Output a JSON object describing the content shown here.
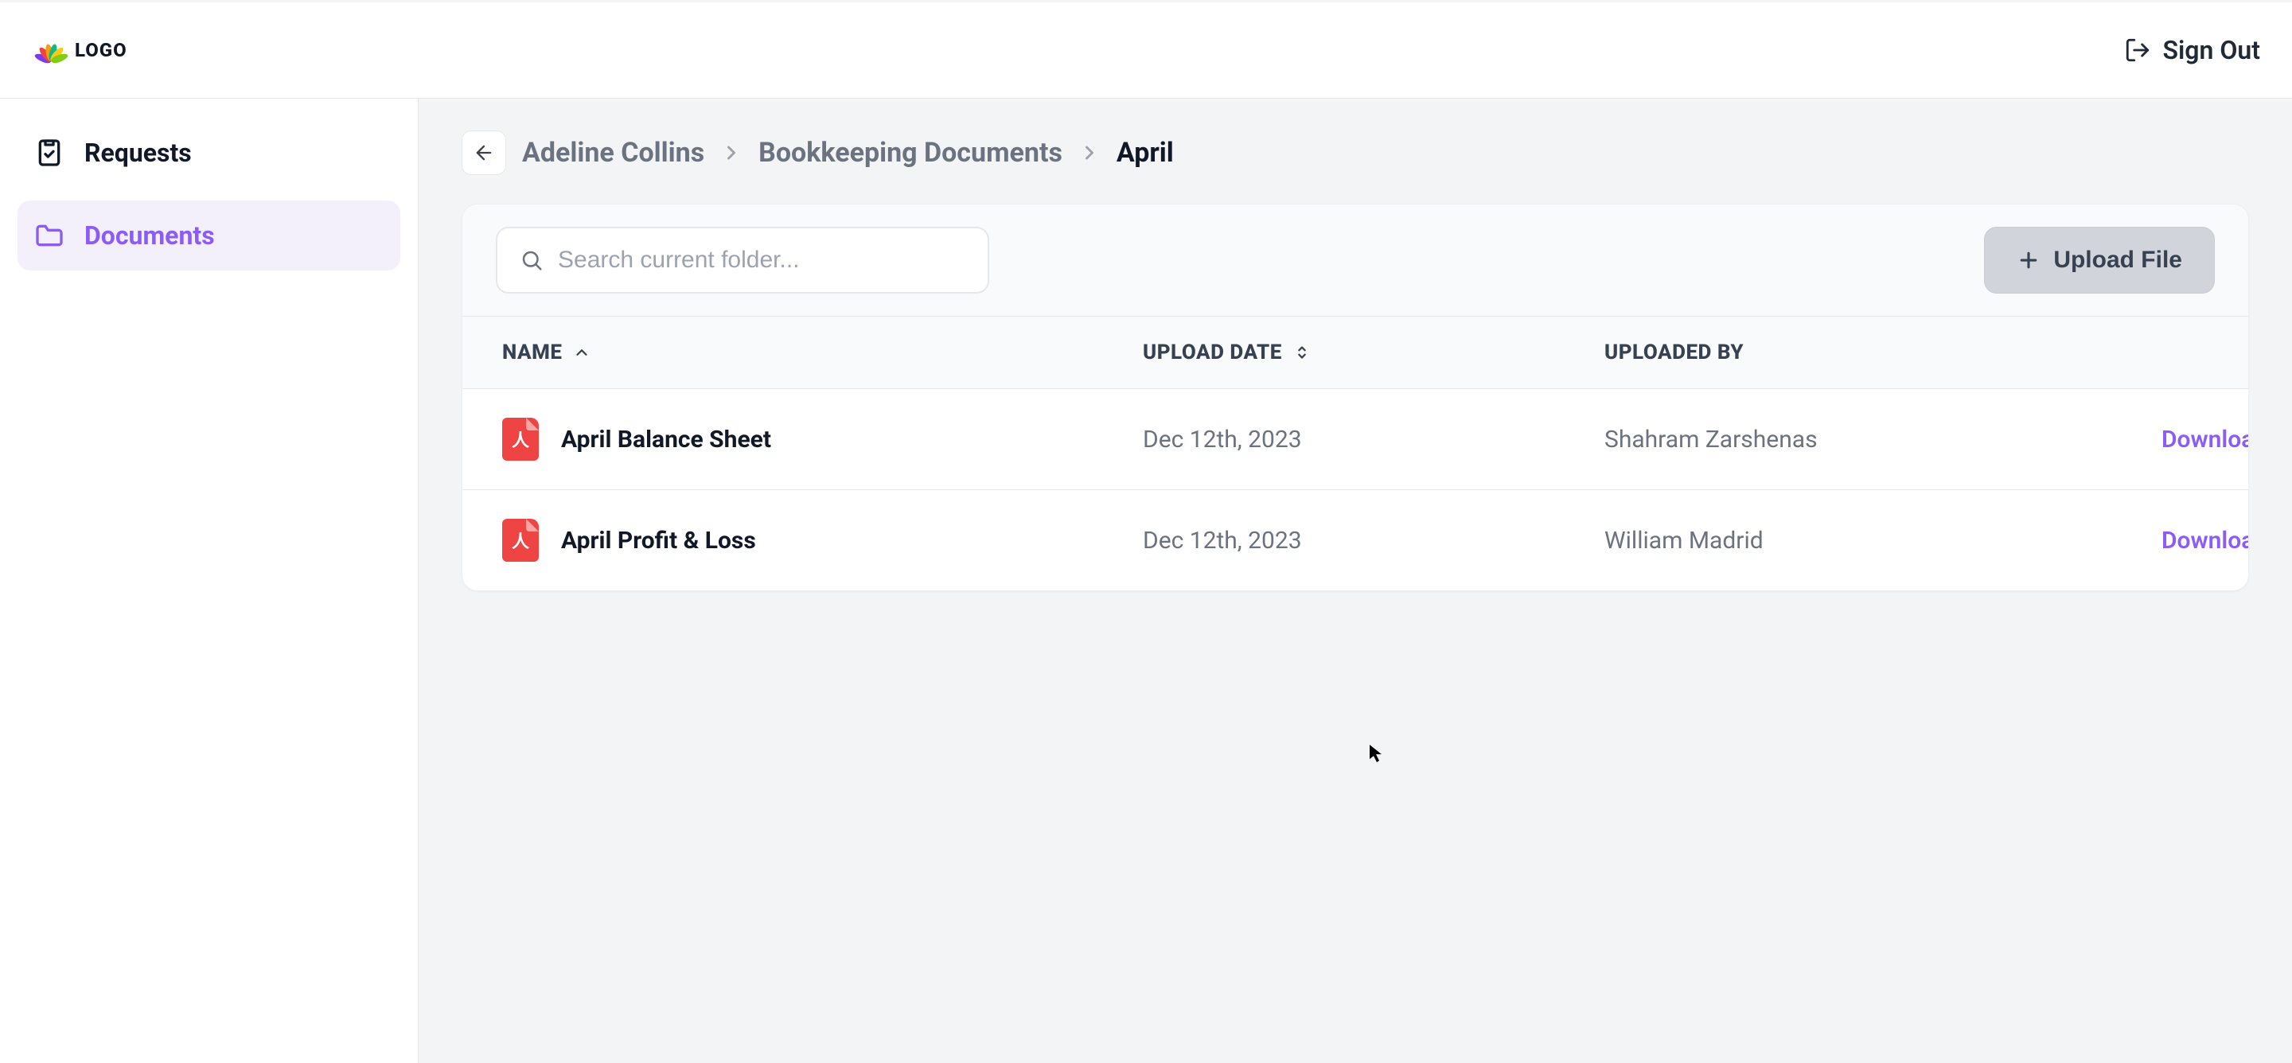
{
  "header": {
    "logo_text": "LOGO",
    "signout_label": "Sign Out"
  },
  "sidebar": {
    "items": [
      {
        "label": "Requests",
        "active": false,
        "icon": "clipboard-check-icon"
      },
      {
        "label": "Documents",
        "active": true,
        "icon": "folder-icon"
      }
    ]
  },
  "breadcrumb": {
    "items": [
      {
        "label": "Adeline Collins",
        "current": false
      },
      {
        "label": "Bookkeeping Documents",
        "current": false
      },
      {
        "label": "April",
        "current": true
      }
    ]
  },
  "search": {
    "placeholder": "Search current folder..."
  },
  "upload_button_label": "Upload File",
  "table": {
    "columns": {
      "name": "NAME",
      "upload_date": "UPLOAD DATE",
      "uploaded_by": "UPLOADED BY"
    },
    "rows": [
      {
        "name": "April Balance Sheet",
        "upload_date": "Dec 12th, 2023",
        "uploaded_by": "Shahram Zarshenas",
        "action": "Download",
        "file_glyph": "人"
      },
      {
        "name": "April Profit & Loss",
        "upload_date": "Dec 12th, 2023",
        "uploaded_by": "William Madrid",
        "action": "Download",
        "file_glyph": "人"
      }
    ]
  },
  "colors": {
    "accent": "#8b5cf6",
    "file_red": "#ef4444"
  }
}
